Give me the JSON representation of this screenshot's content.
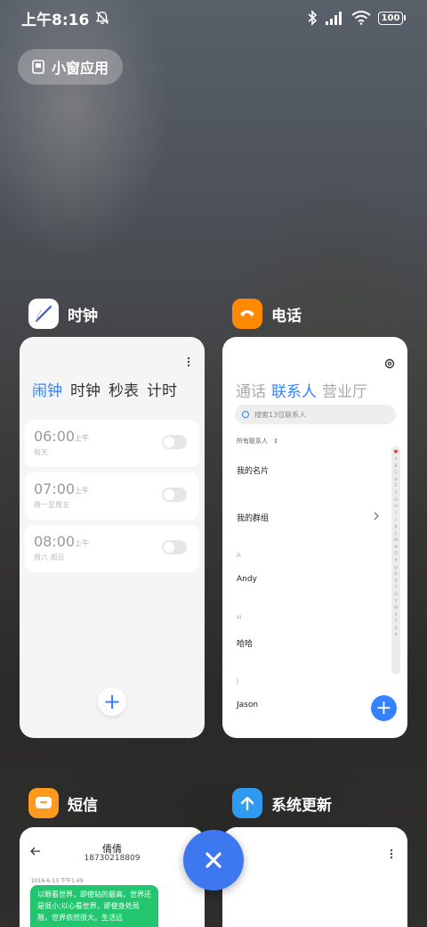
{
  "status_bar": {
    "time": "上午8:16",
    "battery": "100"
  },
  "floating_window": {
    "label": "小窗应用"
  },
  "apps": {
    "clock": {
      "name": "时钟",
      "tabs": [
        "闹钟",
        "时钟",
        "秒表",
        "计时"
      ],
      "alarms": [
        {
          "time": "06:00",
          "ampm": "上午",
          "repeat": "每天"
        },
        {
          "time": "07:00",
          "ampm": "上午",
          "repeat": "周一至周五"
        },
        {
          "time": "08:00",
          "ampm": "上午",
          "repeat": "周六 周日"
        }
      ],
      "add": "+"
    },
    "phone": {
      "name": "电话",
      "tabs": [
        "通话",
        "联系人",
        "营业厅"
      ],
      "search_placeholder": "搜索13位联系人",
      "filter": "所有联系人",
      "my_card": "我的名片",
      "my_groups": "我的群组",
      "contacts": [
        {
          "letter": "A",
          "name": "Andy"
        },
        {
          "letter": "H",
          "name": "哈哈"
        },
        {
          "letter": "J",
          "name": "Jason"
        }
      ],
      "alphabet": [
        "♥",
        "A",
        "B",
        "C",
        "D",
        "E",
        "F",
        "G",
        "H",
        "I",
        "J",
        "K",
        "L",
        "M",
        "N",
        "O",
        "P",
        "Q",
        "R",
        "S",
        "T",
        "U",
        "V",
        "W",
        "X",
        "Y",
        "Z",
        "#"
      ],
      "add": "+"
    },
    "sms": {
      "name": "短信",
      "contact_name": "倩倩",
      "contact_number": "18730218809",
      "date": "2016-6-13 下午1:49",
      "message": "以眼看世界，即使站的最高，世界还是很小;以心看世界，即使身处局限，世界依然很大。生活远"
    },
    "update": {
      "name": "系统更新"
    }
  },
  "colors": {
    "accent": "#3482ff",
    "clock_icon_bg": "#ffffff",
    "phone_icon_bg": "#ff8a00",
    "sms_icon_bg": "#ff9a1f",
    "update_icon_bg": "#2f9bf0",
    "close_button": "#3d78f1",
    "sms_bubble": "#23c66e"
  }
}
